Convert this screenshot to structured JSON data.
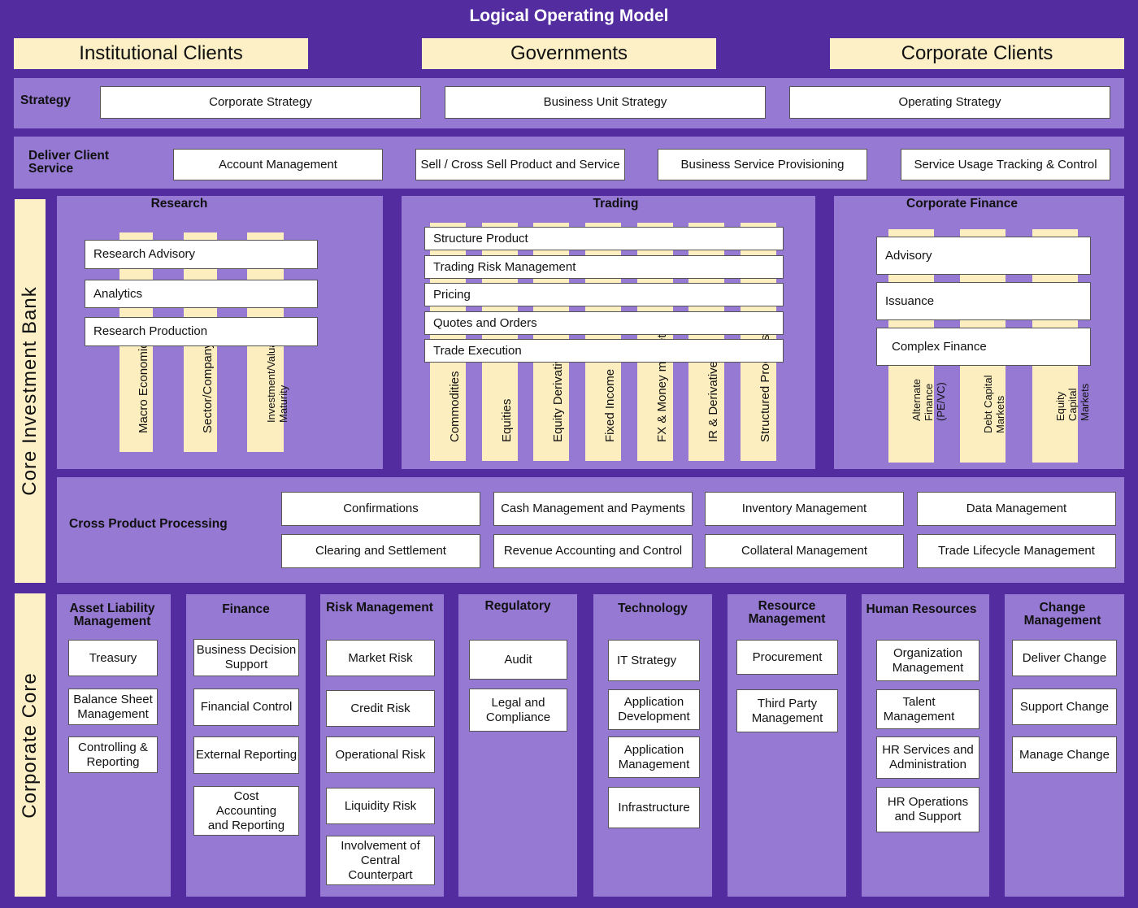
{
  "title": "Logical Operating Model",
  "clients": [
    "Institutional Clients",
    "Governments",
    "Corporate Clients"
  ],
  "strategy": {
    "label": "Strategy",
    "items": [
      "Corporate Strategy",
      "Business Unit Strategy",
      "Operating Strategy"
    ]
  },
  "deliver": {
    "label": "Deliver Client Service",
    "items": [
      "Account Management",
      "Sell / Cross Sell Product and Service",
      "Business Service Provisioning",
      "Service Usage Tracking & Control"
    ]
  },
  "cib": {
    "label": "Core Investment Bank",
    "research": {
      "header": "Research",
      "rows": [
        "Research Advisory",
        "Analytics",
        "Research Production"
      ],
      "columns": [
        "Macro Economics",
        "Sector/Company",
        "Investment/Valuation Maturity"
      ]
    },
    "trading": {
      "header": "Trading",
      "rows": [
        "Structure Product",
        "Trading Risk Management",
        "Pricing",
        "Quotes and Orders",
        "Trade Execution"
      ],
      "columns": [
        "Commodities",
        "Equities",
        "Equity Derivatives",
        "Fixed Income",
        "FX & Money markets",
        "IR & Derivatives",
        "Structured Products"
      ]
    },
    "corporate_finance": {
      "header": "Corporate Finance",
      "rows": [
        "Advisory",
        "Issuance",
        "Complex Finance"
      ],
      "columns": [
        "Alternate Finance (PE/VC)",
        "Debt Capital Markets",
        "Equity Capital Markets"
      ]
    },
    "cross_product": {
      "label": "Cross Product Processing",
      "items": [
        "Confirmations",
        "Cash Management and Payments",
        "Inventory Management",
        "Data Management",
        "Clearing and Settlement",
        "Revenue Accounting  and Control",
        "Collateral Management",
        "Trade Lifecycle Management"
      ]
    }
  },
  "corporate_core": {
    "label": "Corporate Core",
    "columns": [
      {
        "header": "Asset Liability Management",
        "items": [
          "Treasury",
          "Balance Sheet Management",
          "Controlling & Reporting"
        ]
      },
      {
        "header": "Finance",
        "items": [
          "Business Decision Support",
          "Financial Control",
          "External Reporting",
          "Cost Accounting and Reporting"
        ]
      },
      {
        "header": "Risk Management",
        "items": [
          "Market Risk",
          "Credit Risk",
          "Operational Risk",
          "Liquidity Risk",
          "Involvement of Central Counterpart"
        ]
      },
      {
        "header": "Regulatory",
        "items": [
          "Audit",
          "Legal and Compliance"
        ]
      },
      {
        "header": "Technology",
        "items": [
          "IT Strategy",
          "Application Development",
          "Application Management",
          "Infrastructure"
        ]
      },
      {
        "header": "Resource Management",
        "items": [
          "Procurement",
          "Third Party Management"
        ]
      },
      {
        "header": "Human Resources",
        "items": [
          "Organization Management",
          "Talent Management",
          "HR Services and Administration",
          "HR Operations and Support"
        ]
      },
      {
        "header": "Change Management",
        "items": [
          "Deliver Change",
          "Support Change",
          "Manage Change"
        ]
      }
    ]
  },
  "colors": {
    "background": "#532c9f",
    "panel": "#9579d3",
    "cream": "#fdf0c7",
    "box": "#ffffff"
  }
}
